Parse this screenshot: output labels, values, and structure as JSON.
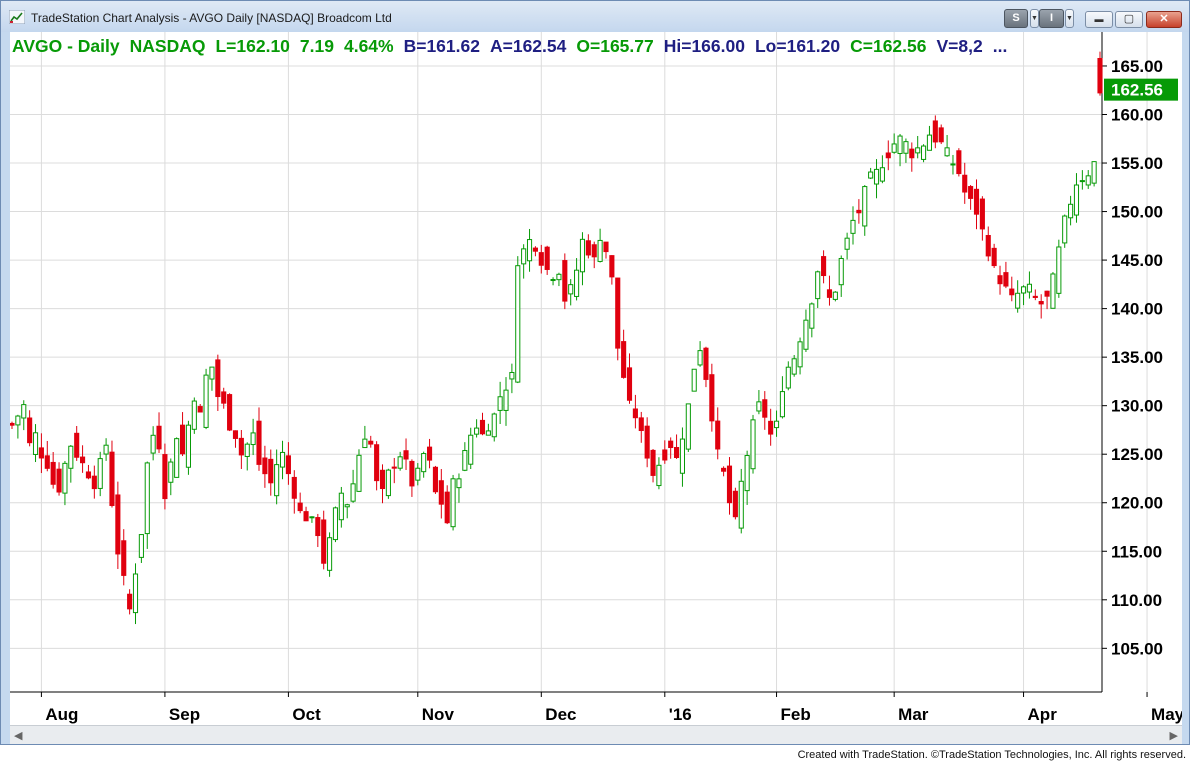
{
  "window": {
    "title": "TradeStation Chart Analysis - AVGO Daily [NASDAQ] Broadcom Ltd",
    "s_button": "S",
    "i_button": "I",
    "minimize": "▬",
    "maximize": "▢",
    "close": "✕"
  },
  "status": {
    "symbol": "AVGO - Daily",
    "exchange": "NASDAQ",
    "last": "L=162.10",
    "change": "7.19",
    "pct": "4.64%",
    "bid": "B=161.62",
    "ask": "A=162.54",
    "open": "O=165.77",
    "high": "Hi=166.00",
    "low": "Lo=161.20",
    "close": "C=162.56",
    "volume": "V=8,2",
    "more": "..."
  },
  "price_tag": "162.56",
  "footer": "Created with TradeStation. ©TradeStation Technologies, Inc. All rights reserved.",
  "colors": {
    "up": "#079a07",
    "down": "#e0000f",
    "grid": "#dcdcdc",
    "axis": "#000000"
  },
  "chart_data": {
    "type": "candlestick",
    "symbol": "AVGO",
    "interval": "Daily",
    "ylim": [
      100.5,
      168.5
    ],
    "yticks": [
      105,
      110,
      115,
      120,
      125,
      130,
      135,
      140,
      145,
      150,
      155,
      160,
      165
    ],
    "ytick_labels": [
      "105.00",
      "110.00",
      "115.00",
      "120.00",
      "125.00",
      "130.00",
      "135.00",
      "140.00",
      "145.00",
      "150.00",
      "155.00",
      "160.00",
      "165.00"
    ],
    "xticks": [
      {
        "bar": 5,
        "label": "Aug"
      },
      {
        "bar": 26,
        "label": "Sep"
      },
      {
        "bar": 47,
        "label": "Oct"
      },
      {
        "bar": 69,
        "label": "Nov"
      },
      {
        "bar": 90,
        "label": "Dec"
      },
      {
        "bar": 111,
        "label": "'16"
      },
      {
        "bar": 130,
        "label": "Feb"
      },
      {
        "bar": 150,
        "label": "Mar"
      },
      {
        "bar": 172,
        "label": "Apr"
      },
      {
        "bar": 193,
        "label": "May"
      }
    ],
    "grid": true,
    "keypoints": [
      [
        0,
        128
      ],
      [
        1,
        129
      ],
      [
        2,
        130
      ],
      [
        3,
        126
      ],
      [
        4,
        127
      ],
      [
        5,
        125
      ],
      [
        6,
        124
      ],
      [
        7,
        122
      ],
      [
        8,
        121.5
      ],
      [
        9,
        124
      ],
      [
        10,
        126
      ],
      [
        11,
        125
      ],
      [
        12,
        124
      ],
      [
        13,
        123
      ],
      [
        14,
        122
      ],
      [
        15,
        124
      ],
      [
        16,
        126
      ],
      [
        17,
        120
      ],
      [
        18,
        115
      ],
      [
        19,
        112
      ],
      [
        20,
        109
      ],
      [
        21,
        113
      ],
      [
        22,
        117
      ],
      [
        23,
        124
      ],
      [
        24,
        127
      ],
      [
        25,
        126
      ],
      [
        26,
        121
      ],
      [
        27,
        124
      ],
      [
        28,
        127
      ],
      [
        29,
        125
      ],
      [
        30,
        128
      ],
      [
        31,
        131
      ],
      [
        32,
        129
      ],
      [
        33,
        133
      ],
      [
        34,
        134
      ],
      [
        35,
        131
      ],
      [
        36,
        130
      ],
      [
        37,
        128
      ],
      [
        38,
        127
      ],
      [
        39,
        125
      ],
      [
        40,
        126
      ],
      [
        41,
        127
      ],
      [
        42,
        124
      ],
      [
        43,
        123
      ],
      [
        44,
        122
      ],
      [
        45,
        124
      ],
      [
        46,
        125
      ],
      [
        47,
        123
      ],
      [
        48,
        121
      ],
      [
        49,
        119
      ],
      [
        50,
        118.5
      ],
      [
        51,
        118
      ],
      [
        52,
        117
      ],
      [
        53,
        114
      ],
      [
        54,
        116
      ],
      [
        55,
        119
      ],
      [
        56,
        121
      ],
      [
        57,
        120
      ],
      [
        58,
        122
      ],
      [
        59,
        125
      ],
      [
        60,
        127
      ],
      [
        61,
        126
      ],
      [
        62,
        122
      ],
      [
        63,
        121
      ],
      [
        64,
        123
      ],
      [
        65,
        124
      ],
      [
        66,
        125
      ],
      [
        67,
        124
      ],
      [
        68,
        122
      ],
      [
        69,
        123
      ],
      [
        70,
        125
      ],
      [
        71,
        124
      ],
      [
        72,
        121
      ],
      [
        73,
        120
      ],
      [
        74,
        118
      ],
      [
        75,
        122
      ],
      [
        76,
        123
      ],
      [
        77,
        125
      ],
      [
        78,
        127
      ],
      [
        79,
        128
      ],
      [
        80,
        127
      ],
      [
        81,
        128
      ],
      [
        82,
        129
      ],
      [
        83,
        131
      ],
      [
        84,
        132
      ],
      [
        85,
        133
      ],
      [
        86,
        145
      ],
      [
        87,
        146
      ],
      [
        88,
        147
      ],
      [
        89,
        146.5
      ],
      [
        90,
        145
      ],
      [
        91,
        144
      ],
      [
        92,
        143.5
      ],
      [
        93,
        144
      ],
      [
        94,
        141
      ],
      [
        95,
        142
      ],
      [
        96,
        144
      ],
      [
        97,
        147
      ],
      [
        98,
        146
      ],
      [
        99,
        145
      ],
      [
        100,
        147.5
      ],
      [
        101,
        146
      ],
      [
        102,
        143
      ],
      [
        103,
        136
      ],
      [
        104,
        133
      ],
      [
        105,
        130
      ],
      [
        106,
        129
      ],
      [
        107,
        127
      ],
      [
        108,
        125
      ],
      [
        109,
        123
      ],
      [
        110,
        124
      ],
      [
        111,
        125
      ],
      [
        112,
        126
      ],
      [
        113,
        124.5
      ],
      [
        114,
        127
      ],
      [
        115,
        130
      ],
      [
        116,
        134
      ],
      [
        117,
        136
      ],
      [
        118,
        133
      ],
      [
        119,
        129
      ],
      [
        120,
        125
      ],
      [
        121,
        123
      ],
      [
        122,
        120
      ],
      [
        123,
        118
      ],
      [
        124,
        122
      ],
      [
        125,
        125
      ],
      [
        126,
        128
      ],
      [
        127,
        130
      ],
      [
        128,
        129
      ],
      [
        129,
        127
      ],
      [
        130,
        128
      ],
      [
        131,
        132
      ],
      [
        132,
        134
      ],
      [
        133,
        135
      ],
      [
        134,
        137
      ],
      [
        135,
        139
      ],
      [
        136,
        141
      ],
      [
        137,
        144
      ],
      [
        138,
        143
      ],
      [
        139,
        141
      ],
      [
        140,
        142
      ],
      [
        141,
        145
      ],
      [
        142,
        147
      ],
      [
        143,
        149
      ],
      [
        144,
        150
      ],
      [
        145,
        152
      ],
      [
        146,
        153.5
      ],
      [
        147,
        154
      ],
      [
        148,
        155
      ],
      [
        149,
        156
      ],
      [
        150,
        157
      ],
      [
        151,
        157.5
      ],
      [
        152,
        157
      ],
      [
        153,
        156
      ],
      [
        154,
        156.5
      ],
      [
        155,
        157
      ],
      [
        156,
        158
      ],
      [
        157,
        157.5
      ],
      [
        158,
        157
      ],
      [
        159,
        156
      ],
      [
        160,
        155
      ],
      [
        161,
        154
      ],
      [
        162,
        152
      ],
      [
        163,
        151
      ],
      [
        164,
        150
      ],
      [
        165,
        148
      ],
      [
        166,
        146
      ],
      [
        167,
        144
      ],
      [
        168,
        143
      ],
      [
        169,
        142
      ],
      [
        170,
        141
      ],
      [
        171,
        141.5
      ],
      [
        172,
        142
      ],
      [
        173,
        142
      ],
      [
        174,
        141
      ],
      [
        175,
        140.5
      ],
      [
        176,
        141
      ],
      [
        177,
        143
      ],
      [
        178,
        146
      ],
      [
        179,
        149
      ],
      [
        180,
        151
      ],
      [
        181,
        153
      ],
      [
        182,
        153.5
      ],
      [
        183,
        154
      ],
      [
        184,
        155
      ],
      [
        185,
        162.5
      ]
    ]
  }
}
